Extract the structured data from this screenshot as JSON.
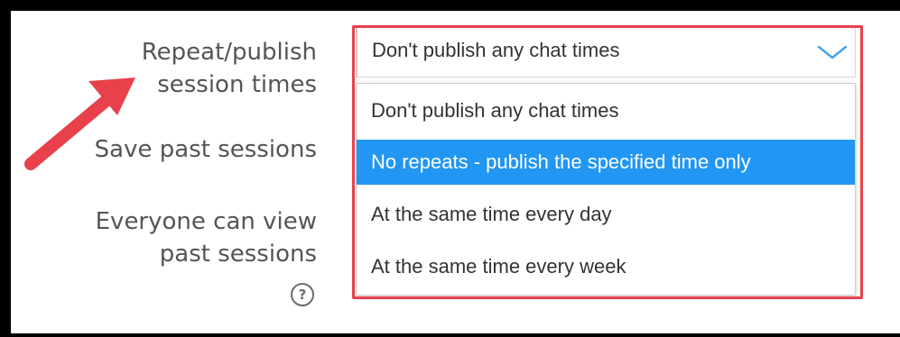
{
  "form": {
    "label_repeat_line1": "Repeat/publish",
    "label_repeat_line2": "session times",
    "label_save": "Save past sessions",
    "label_view_line1": "Everyone can view",
    "label_view_line2": "past sessions",
    "help_glyph": "?"
  },
  "select": {
    "value": "Don't publish any chat times",
    "options": [
      "Don't publish any chat times",
      "No repeats - publish the specified time only",
      "At the same time every day",
      "At the same time every week"
    ],
    "highlighted_index": 1
  },
  "icons": {
    "chevron": "chevron-down-icon",
    "help": "help-icon",
    "annotation_arrow": "pointer-arrow-icon"
  },
  "colors": {
    "highlight_border": "#e8414b",
    "selected_option": "#2196f3",
    "arrow": "#e8414b",
    "chevron": "#4aa3e8"
  }
}
